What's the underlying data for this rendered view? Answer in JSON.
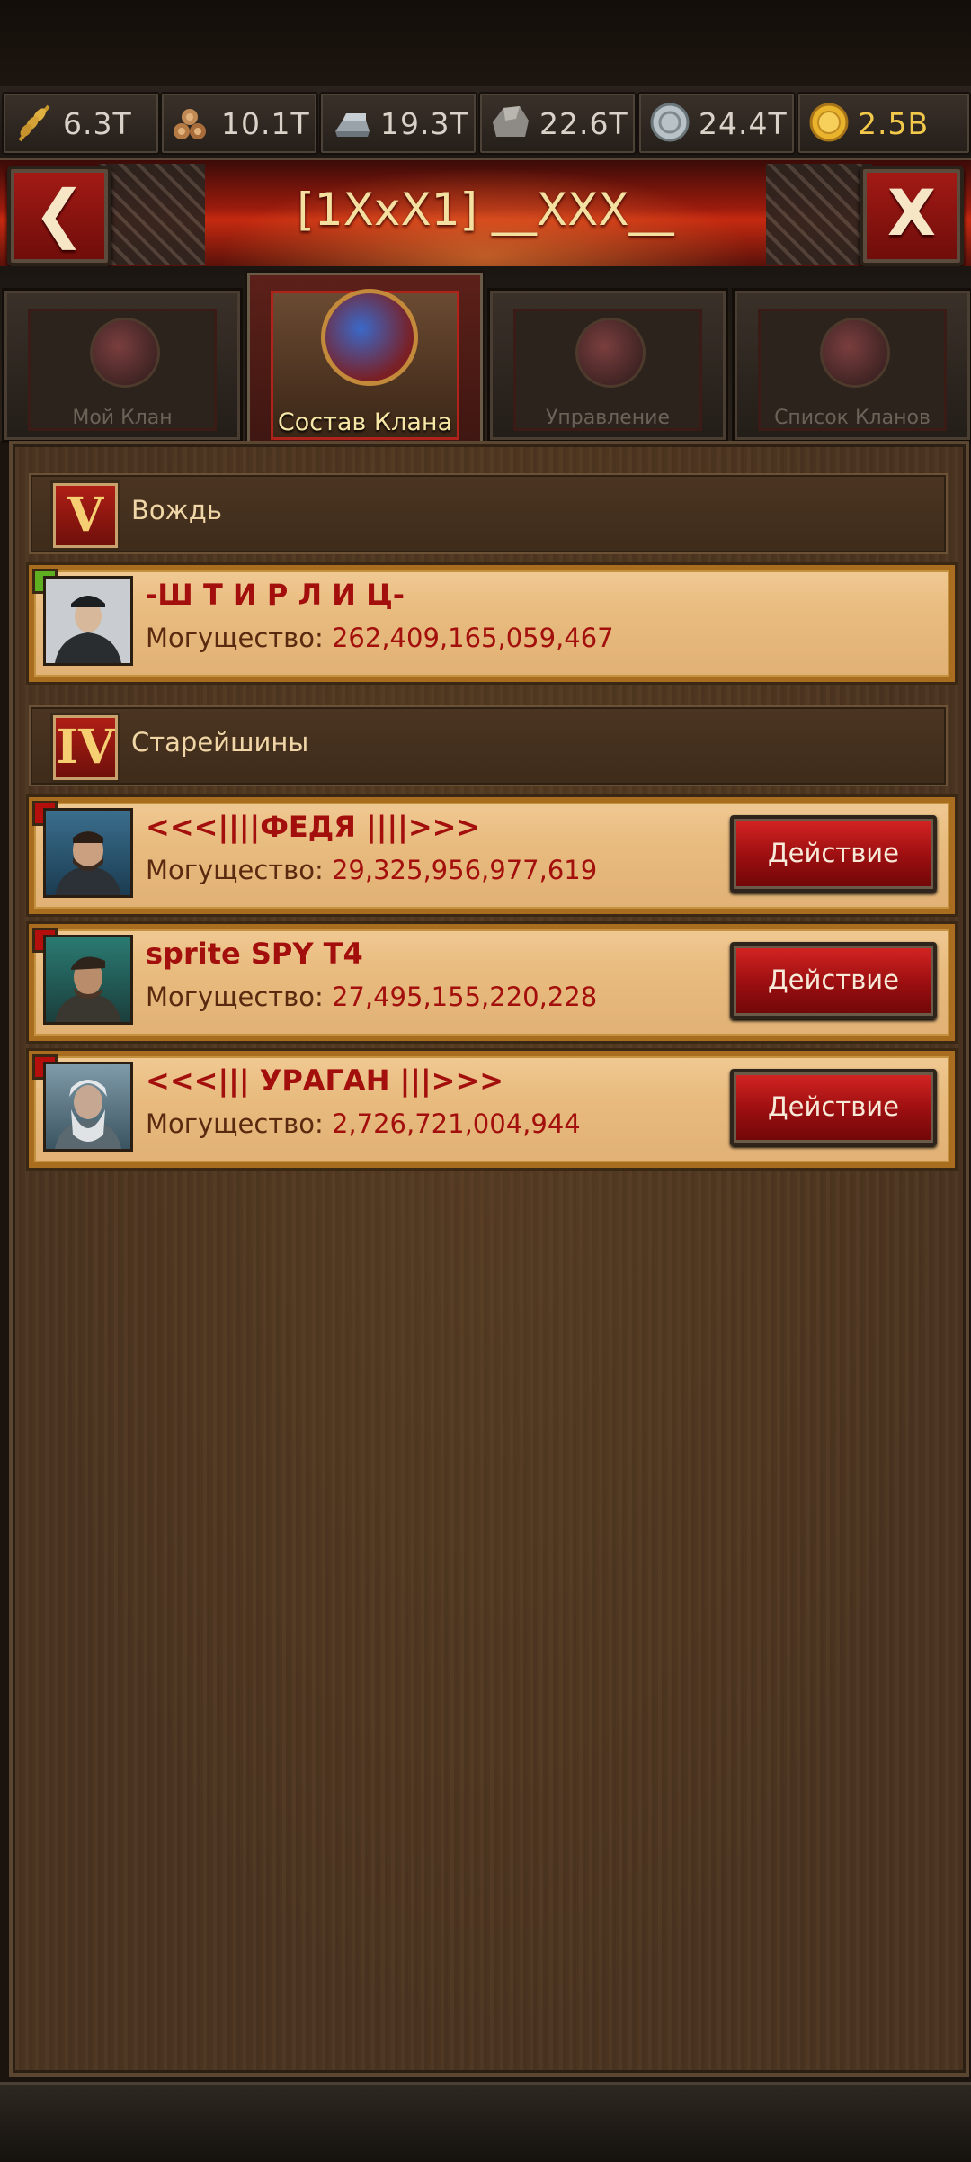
{
  "resources": [
    {
      "icon": "wheat-icon",
      "value": "6.3T"
    },
    {
      "icon": "wood-logs-icon",
      "value": "10.1T"
    },
    {
      "icon": "iron-ingot-icon",
      "value": "19.3T"
    },
    {
      "icon": "stone-icon",
      "value": "22.6T"
    },
    {
      "icon": "silver-coin-icon",
      "value": "24.4T"
    },
    {
      "icon": "gold-coin-icon",
      "value": "2.5B"
    }
  ],
  "header": {
    "title": "[1XxX1] __XXX__",
    "back_label": "❮",
    "close_label": "X"
  },
  "tabs": [
    {
      "label": "Мой Клан",
      "active": false
    },
    {
      "label": "Состав Клана",
      "active": true
    },
    {
      "label": "Управление",
      "active": false
    },
    {
      "label": "Список Кланов",
      "active": false
    }
  ],
  "sections": [
    {
      "rank": "V",
      "title": "Вождь",
      "members": [
        {
          "name": "-Ш Т И Р Л И Ц-",
          "power_label": "Могущество:",
          "power": "262,409,165,059,467",
          "online": true,
          "action": ""
        }
      ]
    },
    {
      "rank": "IV",
      "title": "Старейшины",
      "members": [
        {
          "name": "<<<||||ФЕДЯ ||||>>>",
          "power_label": "Могущество:",
          "power": "29,325,956,977,619",
          "online": false,
          "action": "Действие"
        },
        {
          "name": "sprite SPY T4",
          "power_label": "Могущество:",
          "power": "27,495,155,220,228",
          "online": false,
          "action": "Действие"
        },
        {
          "name": "<<<||| УРАГАН |||>>>",
          "power_label": "Могущество:",
          "power": "2,726,721,004,944",
          "online": false,
          "action": "Действие"
        }
      ]
    }
  ],
  "colors": {
    "accent_red": "#a20f0c",
    "gold": "#f2c94a",
    "online": "#5fb021",
    "offline": "#b40f0c"
  }
}
